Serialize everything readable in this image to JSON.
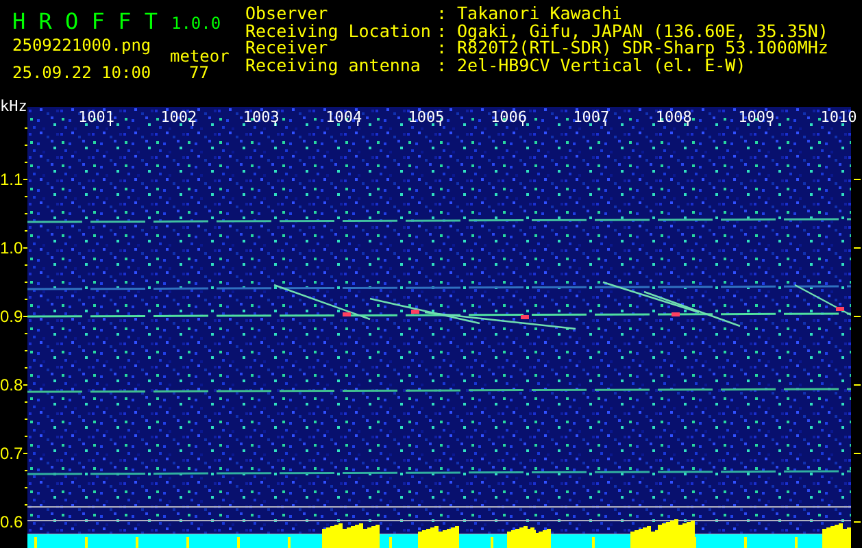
{
  "app": {
    "title": "H R O F F T",
    "version": "1.0.0"
  },
  "file": "2509221000.png",
  "datetime": "25.09.22 10:00",
  "meteor": {
    "label": "meteor",
    "count": "77"
  },
  "info": [
    {
      "label": "Observer",
      "value": ": Takanori Kawachi"
    },
    {
      "label": "Receiving Location",
      "value": ": Ogaki, Gifu, JAPAN (136.60E, 35.35N)"
    },
    {
      "label": "Receiver",
      "value": ": R820T2(RTL-SDR) SDR-Sharp 53.1000MHz"
    },
    {
      "label": "Receiving antenna",
      "value": ": 2el-HB9CV Vertical (el. E-W)"
    }
  ],
  "y_unit": "kHz",
  "x_labels": [
    "1001",
    "1002",
    "1003",
    "1004",
    "1005",
    "1006",
    "1007",
    "1008",
    "1009",
    "1010"
  ],
  "y_labels": [
    "1.1",
    "1.0",
    "0.9",
    "0.8",
    "0.7",
    "0.6"
  ]
}
